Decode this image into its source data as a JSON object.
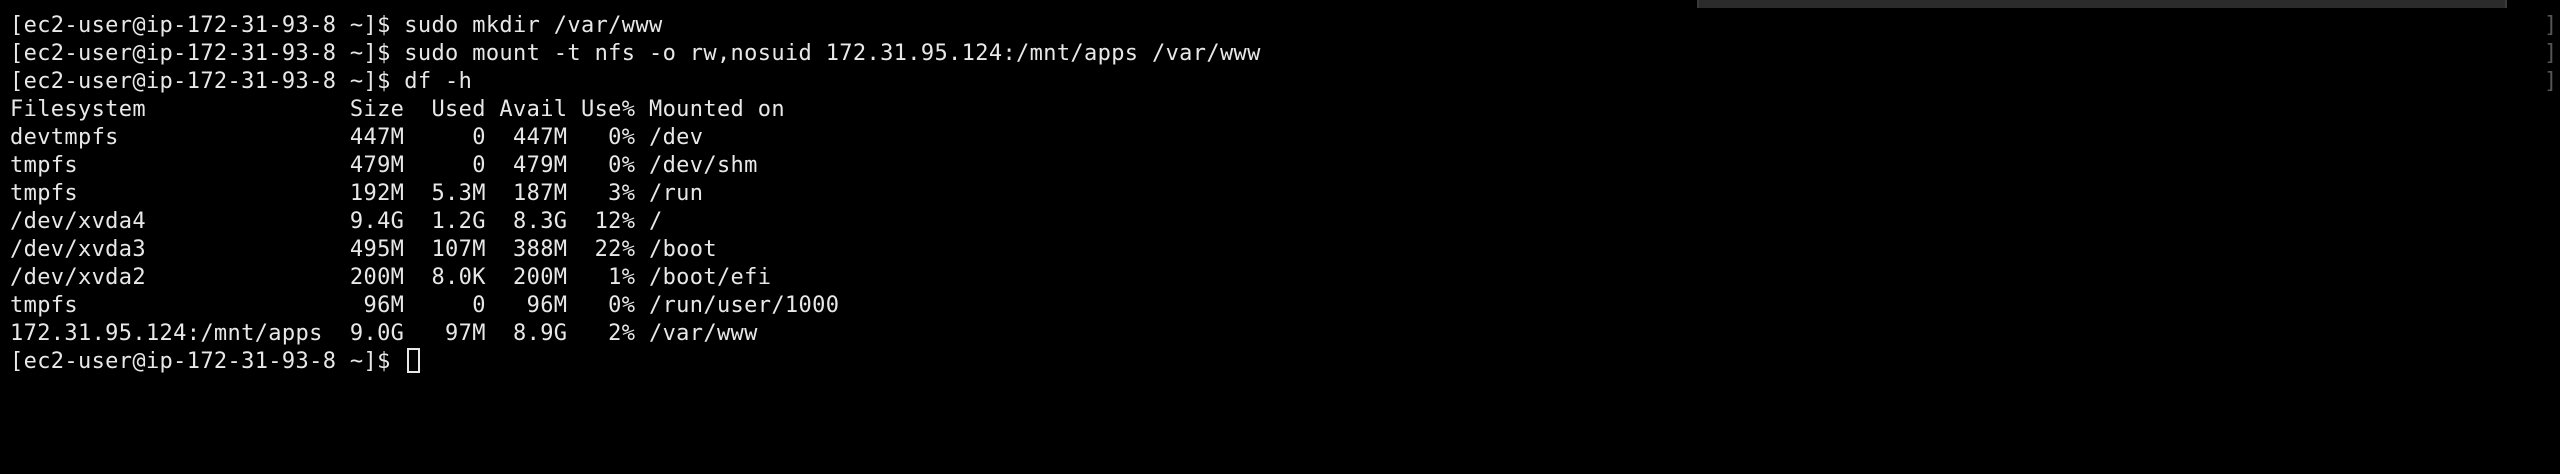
{
  "terminal": {
    "colors": {
      "background": "#000000",
      "foreground": "#e8e8e8",
      "bracket": "#555555"
    },
    "lines": [
      "[ec2-user@ip-172-31-93-8 ~]$ sudo mkdir /var/www",
      "[ec2-user@ip-172-31-93-8 ~]$ sudo mount -t nfs -o rw,nosuid 172.31.95.124:/mnt/apps /var/www",
      "[ec2-user@ip-172-31-93-8 ~]$ df -h",
      "Filesystem               Size  Used Avail Use% Mounted on",
      "devtmpfs                 447M     0  447M   0% /dev",
      "tmpfs                    479M     0  479M   0% /dev/shm",
      "tmpfs                    192M  5.3M  187M   3% /run",
      "/dev/xvda4               9.4G  1.2G  8.3G  12% /",
      "/dev/xvda3               495M  107M  388M  22% /boot",
      "/dev/xvda2               200M  8.0K  200M   1% /boot/efi",
      "tmpfs                     96M     0   96M   0% /run/user/1000",
      "172.31.95.124:/mnt/apps  9.0G   97M  8.9G   2% /var/www"
    ],
    "prompt": "[ec2-user@ip-172-31-93-8 ~]$ "
  }
}
